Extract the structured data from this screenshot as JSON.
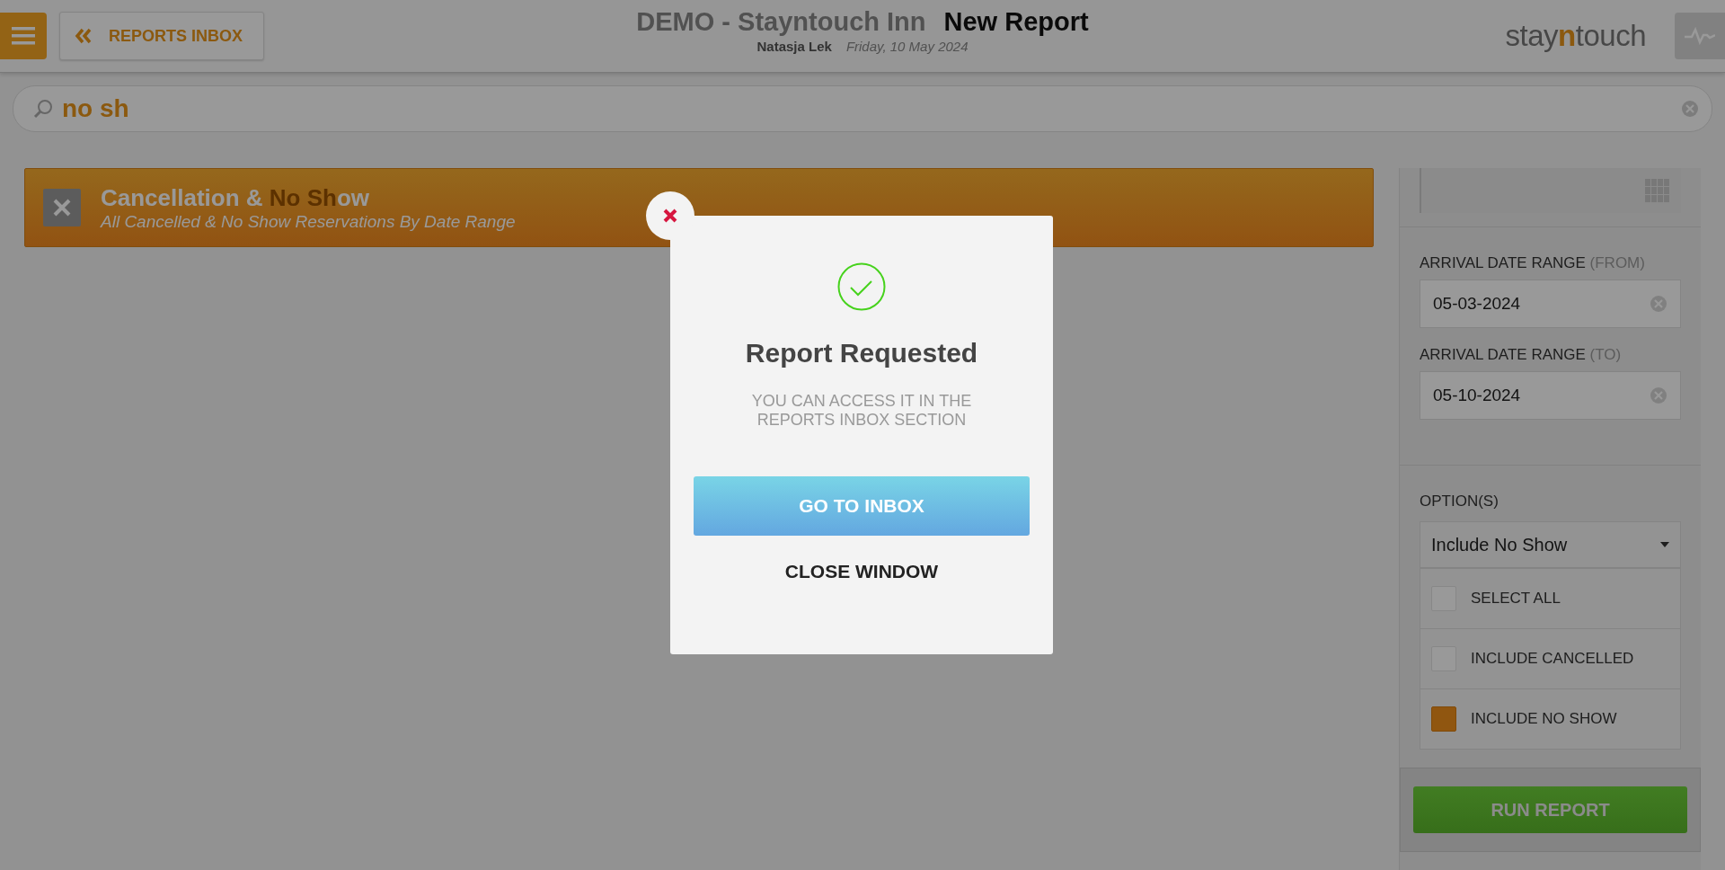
{
  "header": {
    "back_button": "REPORTS INBOX",
    "hotel": "DEMO - Stayntouch Inn",
    "page_title": "New Report",
    "user": "Natasja Lek",
    "date": "Friday, 10 May 2024",
    "logo": {
      "before": "stay",
      "accent": "n",
      "after": "touch"
    }
  },
  "search": {
    "value": "no sh"
  },
  "report_card": {
    "title_parts": [
      {
        "text": "Cancellation & ",
        "match": false
      },
      {
        "text": "No Sh",
        "match": true
      },
      {
        "text": "ow",
        "match": false
      }
    ],
    "subtitle": "All Cancelled & No Show Reservations By Date Range"
  },
  "filters": {
    "date_fields": [
      {
        "label": "ARRIVAL DATE RANGE",
        "qualifier": "(FROM)",
        "value": "05-03-2024"
      },
      {
        "label": "ARRIVAL DATE RANGE",
        "qualifier": "(TO)",
        "value": "05-10-2024"
      }
    ],
    "options": {
      "label": "OPTION(S)",
      "dropdown": "Include No Show",
      "items": [
        {
          "label": "SELECT ALL",
          "checked": false
        },
        {
          "label": "INCLUDE CANCELLED",
          "checked": false
        },
        {
          "label": "INCLUDE NO SHOW",
          "checked": true
        }
      ]
    },
    "run_button": "RUN REPORT"
  },
  "modal": {
    "title": "Report Requested",
    "message": "YOU CAN ACCESS IT IN THE REPORTS INBOX SECTION",
    "primary_button": "GO TO INBOX",
    "secondary_button": "CLOSE WINDOW"
  }
}
